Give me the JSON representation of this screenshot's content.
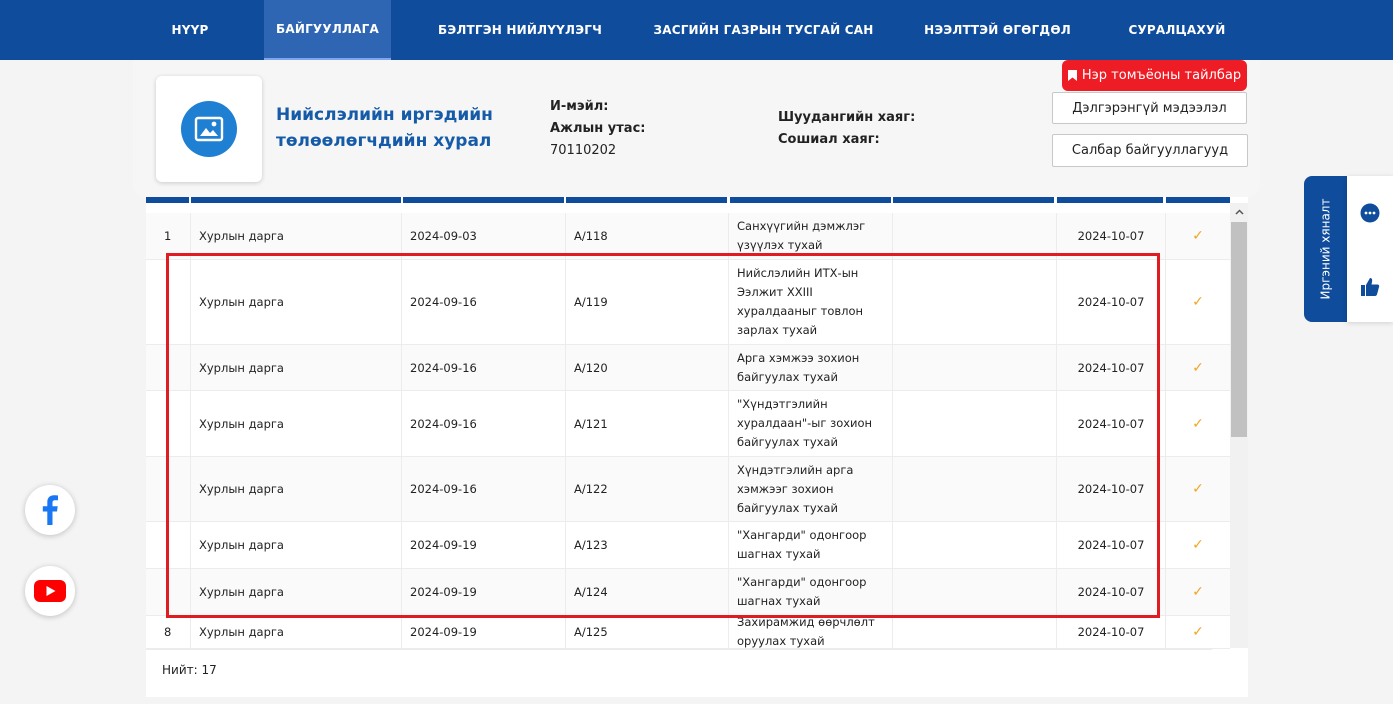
{
  "nav": {
    "items": [
      {
        "label": "НҮҮР"
      },
      {
        "label": "БАЙГУУЛЛАГА"
      },
      {
        "label": "БЭЛТГЭН НИЙЛҮҮЛЭГЧ"
      },
      {
        "label": "ЗАСГИЙН ГАЗРЫН ТУСГАЙ САН"
      },
      {
        "label": "НЭЭЛТТЭЙ ӨГӨГДӨЛ"
      },
      {
        "label": "СУРАЛЦАХУЙ"
      }
    ],
    "active_index": 1
  },
  "org": {
    "name": "Нийслэлийн иргэдийн төлөөлөгчдийн хурал",
    "email_label": "И-мэйл:",
    "email_value": "",
    "phone_label": "Ажлын утас:",
    "phone_value": "70110202",
    "mail_address_label": "Шуудангийн хаяг:",
    "social_label": "Сошиал хаяг:"
  },
  "buttons": {
    "glossary": "Нэр томъёоны тайлбар",
    "details": "Дэлгэрэнгүй мэдээлэл",
    "branches": "Салбар байгууллагууд"
  },
  "table": {
    "rows": [
      {
        "idx": "1",
        "signer": "Хурлын дарга",
        "date": "2024-09-03",
        "number": "А/118",
        "topic": "Санхүүгийн дэмжлэг үзүүлэх тухай",
        "extra": "",
        "posted": "2024-10-07",
        "check": "✓"
      },
      {
        "idx": "",
        "signer": "Хурлын дарга",
        "date": "2024-09-16",
        "number": "А/119",
        "topic": "Нийслэлийн ИТХ-ын Ээлжит XXIII хуралдааныг товлон зарлах тухай",
        "extra": "",
        "posted": "2024-10-07",
        "check": "✓"
      },
      {
        "idx": "",
        "signer": "Хурлын дарга",
        "date": "2024-09-16",
        "number": "А/120",
        "topic": "Арга хэмжээ зохион байгуулах тухай",
        "extra": "",
        "posted": "2024-10-07",
        "check": "✓"
      },
      {
        "idx": "",
        "signer": "Хурлын дарга",
        "date": "2024-09-16",
        "number": "А/121",
        "topic": "\"Хүндэтгэлийн хуралдаан\"-ыг зохион байгуулах тухай",
        "extra": "",
        "posted": "2024-10-07",
        "check": "✓"
      },
      {
        "idx": "",
        "signer": "Хурлын дарга",
        "date": "2024-09-16",
        "number": "А/122",
        "topic": "Хүндэтгэлийн арга хэмжээг зохион байгуулах тухай",
        "extra": "",
        "posted": "2024-10-07",
        "check": "✓"
      },
      {
        "idx": "",
        "signer": "Хурлын дарга",
        "date": "2024-09-19",
        "number": "А/123",
        "topic": "\"Хангарди\" одонгоор шагнах тухай",
        "extra": "",
        "posted": "2024-10-07",
        "check": "✓"
      },
      {
        "idx": "",
        "signer": "Хурлын дарга",
        "date": "2024-09-19",
        "number": "А/124",
        "topic": "\"Хангарди\" одонгоор шагнах тухай",
        "extra": "",
        "posted": "2024-10-07",
        "check": "✓"
      },
      {
        "idx": "8",
        "signer": "Хурлын дарга",
        "date": "2024-09-19",
        "number": "А/125",
        "topic": "Захирамжид өөрчлөлт оруулах тухай",
        "extra": "",
        "posted": "2024-10-07",
        "check": "✓"
      }
    ],
    "total_label": "Нийт: 17"
  },
  "feedback": {
    "tab_label": "Иргэний хяналт"
  },
  "colors": {
    "primary": "#0f4c9c",
    "accent_red": "#ee1c25",
    "check": "#f0a623"
  },
  "icons": [
    "image-icon",
    "bookmark-icon",
    "facebook-icon",
    "youtube-icon",
    "chat-icon",
    "thumbs-up-icon",
    "check-icon"
  ]
}
